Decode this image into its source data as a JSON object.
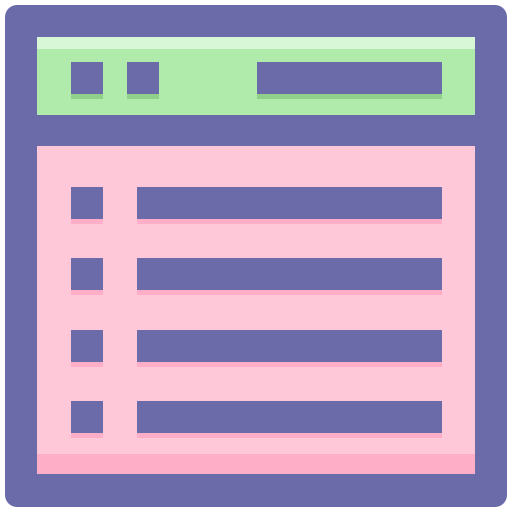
{
  "icon": {
    "name": "browser-list-window",
    "colors": {
      "frame": "#6b6ba9",
      "titlebar": "#b1ebab",
      "titlebar_highlight": "#d8f7d6",
      "content": "#ffc8d9",
      "content_shadow": "#ffaec7"
    },
    "titlebar_controls": [
      "square-control",
      "square-control",
      "address-bar"
    ],
    "list_rows": 4
  }
}
